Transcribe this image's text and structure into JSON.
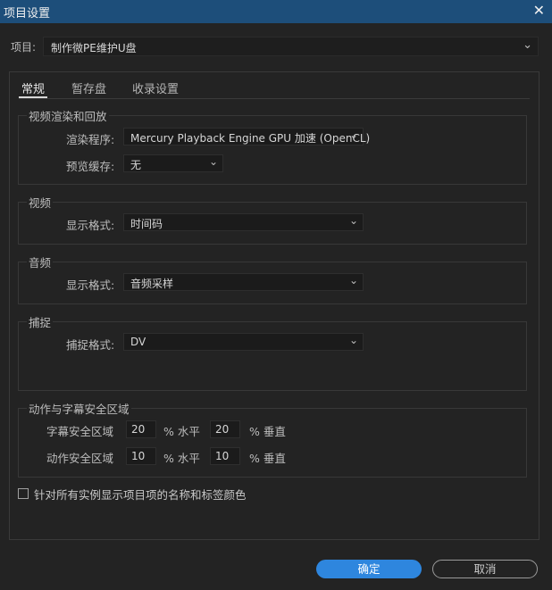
{
  "window": {
    "title": "项目设置",
    "close_icon": "close-icon"
  },
  "project": {
    "label": "项目:",
    "value": "制作微PE维护U盘"
  },
  "tabs": [
    {
      "label": "常规",
      "active": true
    },
    {
      "label": "暂存盘",
      "active": false
    },
    {
      "label": "收录设置",
      "active": false
    }
  ],
  "render": {
    "group": "视频渲染和回放",
    "renderer_label": "渲染程序:",
    "renderer_value": "Mercury Playback Engine GPU 加速 (OpenCL)",
    "preview_label": "预览缓存:",
    "preview_value": "无"
  },
  "video": {
    "group": "视频",
    "format_label": "显示格式:",
    "format_value": "时间码"
  },
  "audio": {
    "group": "音频",
    "format_label": "显示格式:",
    "format_value": "音频采样"
  },
  "capture": {
    "group": "捕捉",
    "format_label": "捕捉格式:",
    "format_value": "DV"
  },
  "safe": {
    "group": "动作与字幕安全区域",
    "title_label": "字幕安全区域",
    "title_h": "20",
    "title_v": "20",
    "action_label": "动作安全区域",
    "action_h": "10",
    "action_v": "10",
    "unit_h": "% 水平",
    "unit_v": "% 垂直"
  },
  "checkbox_label": "针对所有实例显示项目项的名称和标签颜色",
  "buttons": {
    "ok": "确定",
    "cancel": "取消"
  },
  "colors": {
    "titlebar": "#1d4e7a",
    "accent": "#2e86de",
    "background": "#232323"
  }
}
